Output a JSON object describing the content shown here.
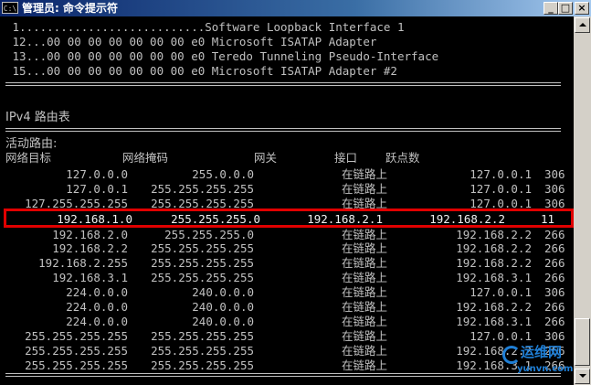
{
  "window": {
    "title": "管理员: 命令提示符",
    "icon_label": "C:\\",
    "buttons": {
      "minimize": "_",
      "maximize": "□",
      "close": "×"
    }
  },
  "interfaces": [
    " 1...........................Software Loopback Interface 1",
    " 12...00 00 00 00 00 00 00 e0 Microsoft ISATAP Adapter",
    " 13...00 00 00 00 00 00 00 e0 Teredo Tunneling Pseudo-Interface",
    " 15...00 00 00 00 00 00 00 e0 Microsoft ISATAP Adapter #2"
  ],
  "ipv4_title": "IPv4 路由表",
  "active_routes": "活动路由:",
  "headers": {
    "dest": "网络目标",
    "mask": "网络掩码",
    "gateway": "网关",
    "iface": "接口",
    "metric": "跃点数"
  },
  "routes": [
    {
      "dest": "127.0.0.0",
      "mask": "255.0.0.0",
      "gateway": "在链路上",
      "iface": "127.0.0.1",
      "metric": "306"
    },
    {
      "dest": "127.0.0.1",
      "mask": "255.255.255.255",
      "gateway": "在链路上",
      "iface": "127.0.0.1",
      "metric": "306"
    },
    {
      "dest": "127.255.255.255",
      "mask": "255.255.255.255",
      "gateway": "在链路上",
      "iface": "127.0.0.1",
      "metric": "306"
    },
    {
      "dest": "192.168.2.0",
      "mask": "255.255.255.0",
      "gateway": "在链路上",
      "iface": "192.168.2.2",
      "metric": "266"
    },
    {
      "dest": "192.168.2.2",
      "mask": "255.255.255.255",
      "gateway": "在链路上",
      "iface": "192.168.2.2",
      "metric": "266"
    },
    {
      "dest": "192.168.2.255",
      "mask": "255.255.255.255",
      "gateway": "在链路上",
      "iface": "192.168.2.2",
      "metric": "266"
    },
    {
      "dest": "192.168.3.1",
      "mask": "255.255.255.255",
      "gateway": "在链路上",
      "iface": "192.168.3.1",
      "metric": "266"
    },
    {
      "dest": "224.0.0.0",
      "mask": "240.0.0.0",
      "gateway": "在链路上",
      "iface": "127.0.0.1",
      "metric": "306"
    },
    {
      "dest": "224.0.0.0",
      "mask": "240.0.0.0",
      "gateway": "在链路上",
      "iface": "192.168.2.2",
      "metric": "266"
    },
    {
      "dest": "224.0.0.0",
      "mask": "240.0.0.0",
      "gateway": "在链路上",
      "iface": "192.168.3.1",
      "metric": "266"
    },
    {
      "dest": "255.255.255.255",
      "mask": "255.255.255.255",
      "gateway": "在链路上",
      "iface": "127.0.0.1",
      "metric": "306"
    },
    {
      "dest": "255.255.255.255",
      "mask": "255.255.255.255",
      "gateway": "在链路上",
      "iface": "192.168.2.2",
      "metric": "266"
    },
    {
      "dest": "255.255.255.255",
      "mask": "255.255.255.255",
      "gateway": "在链路上",
      "iface": "192.168.3.1",
      "metric": "266"
    }
  ],
  "highlighted_route": {
    "dest": "192.168.1.0",
    "mask": "255.255.255.0",
    "gateway": "192.168.2.1",
    "iface": "192.168.2.2",
    "metric": "11"
  },
  "watermark": {
    "text": "运维网",
    "url": "yunvn.com"
  },
  "colors": {
    "text": "#c0c0c0",
    "background": "#000000",
    "highlight_border": "#e00000",
    "watermark": "#1f7fd6"
  }
}
